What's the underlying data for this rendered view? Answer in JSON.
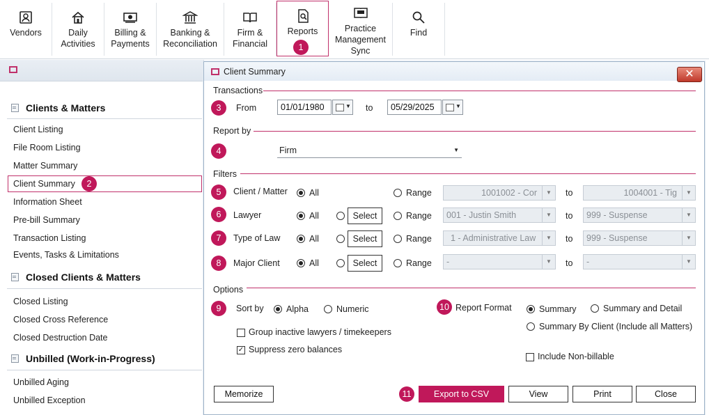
{
  "ribbon": {
    "vendors": "Vendors",
    "daily1": "Daily",
    "daily2": "Activities",
    "billing1": "Billing &",
    "billing2": "Payments",
    "banking1": "Banking &",
    "banking2": "Reconciliation",
    "firm1": "Firm &",
    "firm2": "Financial",
    "reports": "Reports",
    "pms1": "Practice",
    "pms2": "Management",
    "pms3": "Sync",
    "find": "Find"
  },
  "badges": [
    "1",
    "2",
    "3",
    "4",
    "5",
    "6",
    "7",
    "8",
    "9",
    "10",
    "11"
  ],
  "left": {
    "sections": [
      "Clients & Matters",
      "Closed Clients & Matters",
      "Unbilled (Work-in-Progress)"
    ],
    "clients": [
      "Client Listing",
      "File Room Listing",
      "Matter Summary",
      "Client Summary",
      "Information Sheet",
      "Pre-bill Summary",
      "Transaction Listing",
      "Events, Tasks & Limitations"
    ],
    "closed": [
      "Closed Listing",
      "Closed Cross Reference",
      "Closed Destruction Date"
    ],
    "unbilled": [
      "Unbilled Aging",
      "Unbilled Exception"
    ]
  },
  "dialog": {
    "title": "Client Summary",
    "transactions": "Transactions",
    "from": "From",
    "from_date": "01/01/1980",
    "to": "to",
    "to_date": "05/29/2025",
    "report_by": "Report by",
    "firm": "Firm",
    "filters": "Filters",
    "all": "All",
    "range": "Range",
    "select": "Select",
    "client_matter": "Client / Matter",
    "cm_from": "1001002 - Cor",
    "cm_to": "1004001 - Tig",
    "lawyer": "Lawyer",
    "lawyer_from": "001 - Justin Smith",
    "lawyer_to": "999 - Suspense",
    "type_of_law": "Type of Law",
    "tol_from": "1 - Administrative Law",
    "tol_to": "999 - Suspense",
    "major_client": "Major Client",
    "mc_from": "-",
    "mc_to": "-",
    "options": "Options",
    "sort_by": "Sort by",
    "alpha": "Alpha",
    "numeric": "Numeric",
    "group_inactive": "Group inactive lawyers / timekeepers",
    "suppress_zero": "Suppress zero balances",
    "report_format": "Report Format",
    "summary": "Summary",
    "summary_detail": "Summary and Detail",
    "summary_by_client": "Summary By Client (Include all Matters)",
    "include_nonbillable": "Include Non-billable",
    "memorize": "Memorize",
    "export_csv": "Export to CSV",
    "view": "View",
    "print": "Print",
    "close": "Close"
  }
}
